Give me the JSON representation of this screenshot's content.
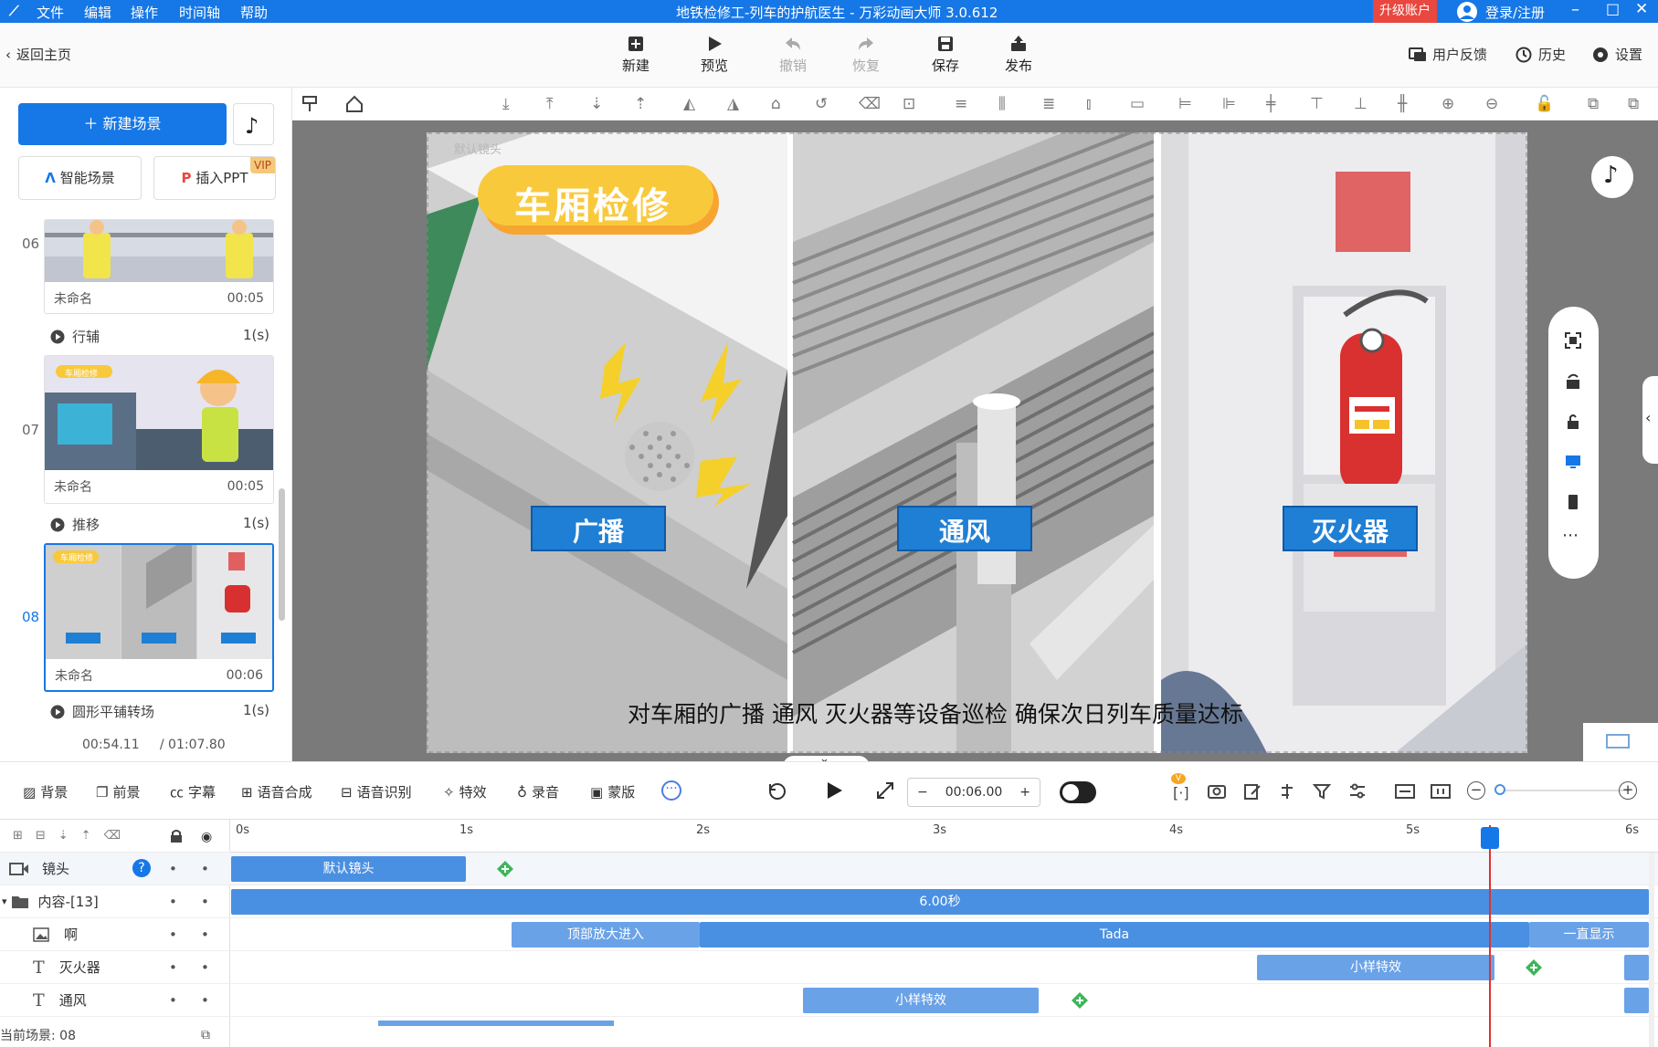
{
  "title_bar": {
    "menu": [
      "文件",
      "编辑",
      "操作",
      "时间轴",
      "帮助"
    ],
    "window_title": "地铁检修工-列车的护航医生 - 万彩动画大师 3.0.612",
    "upgrade": "升级账户",
    "login": "登录/注册"
  },
  "toolbar": {
    "back": "返回主页",
    "new": "新建",
    "preview": "预览",
    "undo": "撤销",
    "redo": "恢复",
    "save": "保存",
    "publish": "发布",
    "feedback": "用户反馈",
    "history": "历史",
    "settings": "设置"
  },
  "left_panel": {
    "new_scene": "新建场景",
    "smart_scene": "智能场景",
    "insert_ppt": "插入PPT",
    "vip": "VIP",
    "scenes": [
      {
        "num": "06",
        "name": "未命名",
        "duration": "00:05",
        "transition": "行辅",
        "trans_dur": "1(s)"
      },
      {
        "num": "07",
        "name": "未命名",
        "duration": "00:05",
        "transition": "推移",
        "trans_dur": "1(s)"
      },
      {
        "num": "08",
        "name": "未命名",
        "duration": "00:06",
        "transition": "圆形平铺转场",
        "trans_dur": "1(s)"
      }
    ],
    "time_current": "00:54.11",
    "time_total": "/ 01:07.80",
    "thumb_tag": "车厢检修"
  },
  "canvas": {
    "camera_label": "默认镜头",
    "banner": "车厢检修",
    "labels": [
      "广播",
      "通风",
      "灭火器"
    ],
    "subtitle": "对车厢的广播 通风 灭火器等设备巡检 确保次日列车质量达标"
  },
  "bottom_toolbar": {
    "items": [
      "背景",
      "前景",
      "字幕",
      "语音合成",
      "语音识别",
      "特效",
      "录音",
      "蒙版"
    ],
    "time": "00:06.00",
    "minus": "−",
    "plus": "+"
  },
  "timeline": {
    "ticks": [
      "0s",
      "1s",
      "2s",
      "3s",
      "4s",
      "5s",
      "6s"
    ],
    "tracks": [
      {
        "name": "镜头"
      },
      {
        "name": "内容-[13]"
      },
      {
        "name": "啊"
      },
      {
        "name": "灭火器"
      },
      {
        "name": "通风"
      }
    ],
    "bars": {
      "camera": "默认镜头",
      "content": "6.00秒",
      "a_1": "顶部放大进入",
      "a_2": "Tada",
      "a_3": "一直显示",
      "fire": "小样特效",
      "vent": "小样特效"
    },
    "current_scene": "当前场景: 08"
  },
  "colors": {
    "accent": "#1677e6",
    "upgrade": "#e9473f",
    "bar_blue": "#4a90e2",
    "label_blue": "#1f7fd4",
    "banner_yellow": "#f9c93c",
    "playhead": "#e03030"
  }
}
